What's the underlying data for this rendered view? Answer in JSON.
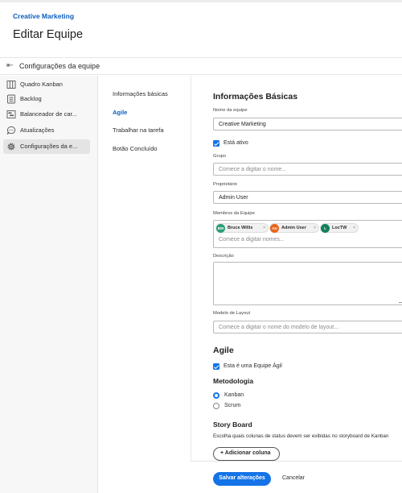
{
  "header": {
    "team_name": "Creative Marketing",
    "title": "Editar Equipe"
  },
  "back": {
    "label": "Configurações da equipe"
  },
  "sidebar": {
    "items": [
      {
        "label": "Quadro Kanban",
        "icon": "kanban-board-icon"
      },
      {
        "label": "Backlog",
        "icon": "backlog-icon"
      },
      {
        "label": "Balanceador de car...",
        "icon": "workload-balancer-icon"
      },
      {
        "label": "Atualizações",
        "icon": "updates-icon"
      },
      {
        "label": "Configurações da e...",
        "icon": "gear-icon",
        "active": true
      }
    ]
  },
  "subnav": {
    "items": [
      {
        "label": "Informações básicas"
      },
      {
        "label": "Agile",
        "active": true
      },
      {
        "label": "Trabalhar na tarefa"
      },
      {
        "label": "Botão Concluído"
      }
    ]
  },
  "basic": {
    "heading": "Informações Básicas",
    "team_name_label": "Nome da equipe",
    "team_name_value": "Creative Marketing",
    "active_label": "Está ativo",
    "group_label": "Grupo",
    "group_placeholder": "Comece a digitar o nome...",
    "owner_label": "Proprietário",
    "owner_value": "Admin User",
    "members_label": "Membros da Equipe",
    "members": [
      {
        "initials": "BW",
        "name": "Bruce Willis",
        "color": "#2d9d78"
      },
      {
        "initials": "AU",
        "name": "Admin User",
        "color": "#e8641b"
      },
      {
        "initials": "L",
        "name": "LocTW",
        "color": "#12805c"
      }
    ],
    "members_placeholder": "Comece a digitar nomes...",
    "description_label": "Descrição",
    "layout_label": "Modelo de Layout",
    "layout_placeholder": "Comece a digitar o nome do modelo de layout..."
  },
  "agile": {
    "heading": "Agile",
    "agile_team_label": "Esta é uma Equipe Ágil",
    "methodology_heading": "Metodologia",
    "kanban_label": "Kanban",
    "scrum_label": "Scrum",
    "storyboard_heading": "Story Board",
    "storyboard_desc": "Escolha quais colunas de status devem ser exibidas no storyboard de Kanban",
    "add_column_label": "+ Adicionar coluna"
  },
  "footer": {
    "save_label": "Salvar alterações",
    "cancel_label": "Cancelar"
  },
  "colors": {
    "accent": "#1473e6",
    "link": "#0b5ec0"
  }
}
